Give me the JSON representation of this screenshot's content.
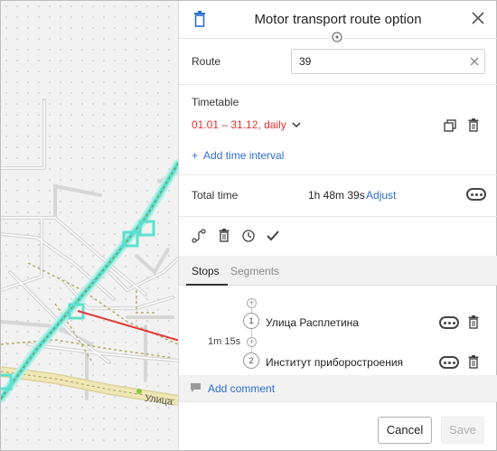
{
  "header": {
    "title": "Motor transport route option"
  },
  "route": {
    "label": "Route",
    "value": "39"
  },
  "timetable": {
    "label": "Timetable",
    "period": "01.01 – 31.12, daily",
    "add_interval": "Add time interval"
  },
  "total_time": {
    "label": "Total time",
    "value": "1h 48m 39s",
    "adjust": "Adjust"
  },
  "tabs": [
    {
      "label": "Stops",
      "active": true
    },
    {
      "label": "Segments",
      "active": false
    }
  ],
  "stops": [
    {
      "number": "1",
      "name": "Улица Расплетина"
    },
    {
      "number": "2",
      "name": "Институт приборостроения"
    }
  ],
  "segment_time": "1m 15s",
  "comment": {
    "label": "Add comment"
  },
  "footer": {
    "cancel": "Cancel",
    "save": "Save"
  },
  "map": {
    "street_label": "Улица"
  },
  "colors": {
    "accent": "#2d6fd0",
    "timetable_red": "#e03131",
    "route_line": "#5de0cf",
    "arrow": "#e53935",
    "road_yellow": "#efe7b6"
  },
  "icons": {
    "header_delete": "trash-icon",
    "close": "close-icon",
    "move_handle": "crosshair-icon",
    "clear": "clear-icon",
    "chevron": "chevron-down-icon",
    "copy": "copy-icon",
    "timetable_delete": "trash-icon",
    "more": "more-dots-icon",
    "tools": [
      "reroute-icon",
      "trash-icon",
      "clock-icon",
      "check-icon"
    ],
    "comment": "comment-icon"
  }
}
